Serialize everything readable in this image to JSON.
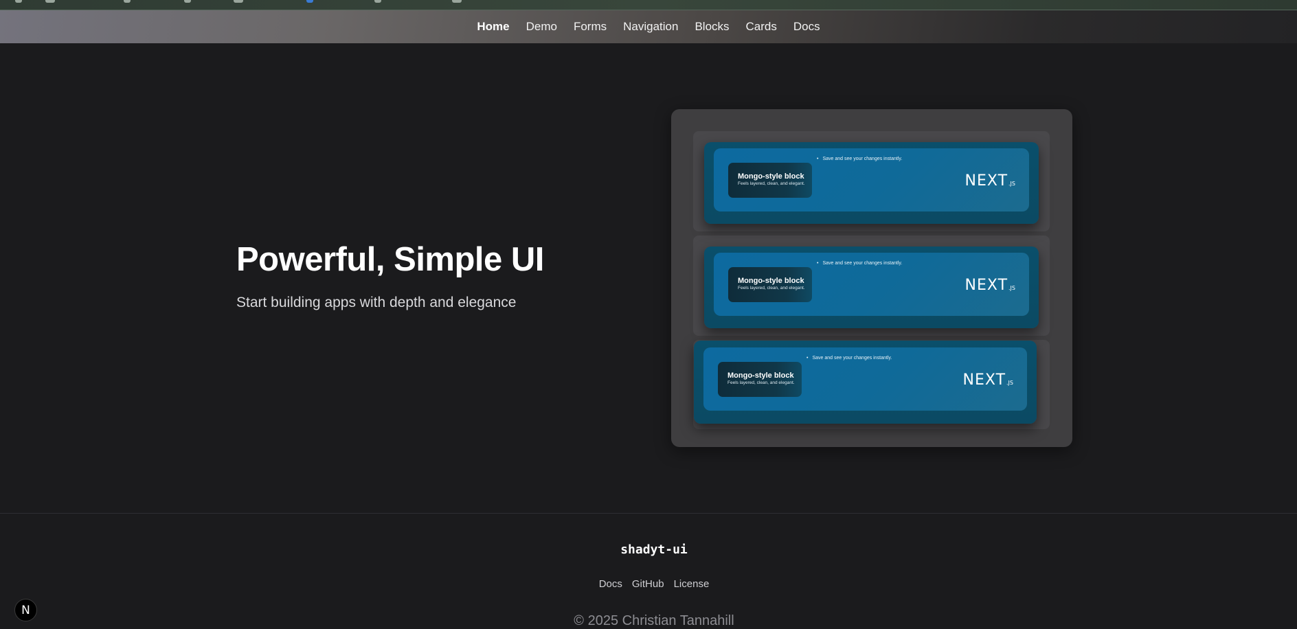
{
  "nav": {
    "items": [
      {
        "label": "Home",
        "active": true
      },
      {
        "label": "Demo",
        "active": false
      },
      {
        "label": "Forms",
        "active": false
      },
      {
        "label": "Navigation",
        "active": false
      },
      {
        "label": "Blocks",
        "active": false
      },
      {
        "label": "Cards",
        "active": false
      },
      {
        "label": "Docs",
        "active": false
      }
    ]
  },
  "hero": {
    "title": "Powerful, Simple UI",
    "subtitle": "Start building apps with depth and elegance"
  },
  "showcase": {
    "blocks": [
      {
        "title": "Mongo-style block",
        "subtitle": "Feels layered, clean, and elegant.",
        "bullet": "Save and see your changes instantly.",
        "logo": "NEXT",
        "logo_suffix": ".JS"
      },
      {
        "title": "Mongo-style block",
        "subtitle": "Feels layered, clean, and elegant.",
        "bullet": "Save and see your changes instantly.",
        "logo": "NEXT",
        "logo_suffix": ".JS"
      },
      {
        "title": "Mongo-style block",
        "subtitle": "Feels layered, clean, and elegant.",
        "bullet": "Save and see your changes instantly.",
        "logo": "NEXT",
        "logo_suffix": ".JS"
      }
    ]
  },
  "footer": {
    "brand": "shadyt-ui",
    "links": [
      "Docs",
      "GitHub",
      "License"
    ],
    "copyright": "© 2025 Christian Tannahill"
  },
  "badge": {
    "label": "N"
  },
  "colors": {
    "background": "#1b1b1d",
    "block_accent": "#0d6aa0",
    "showcase_bg": "#3f3e40"
  }
}
